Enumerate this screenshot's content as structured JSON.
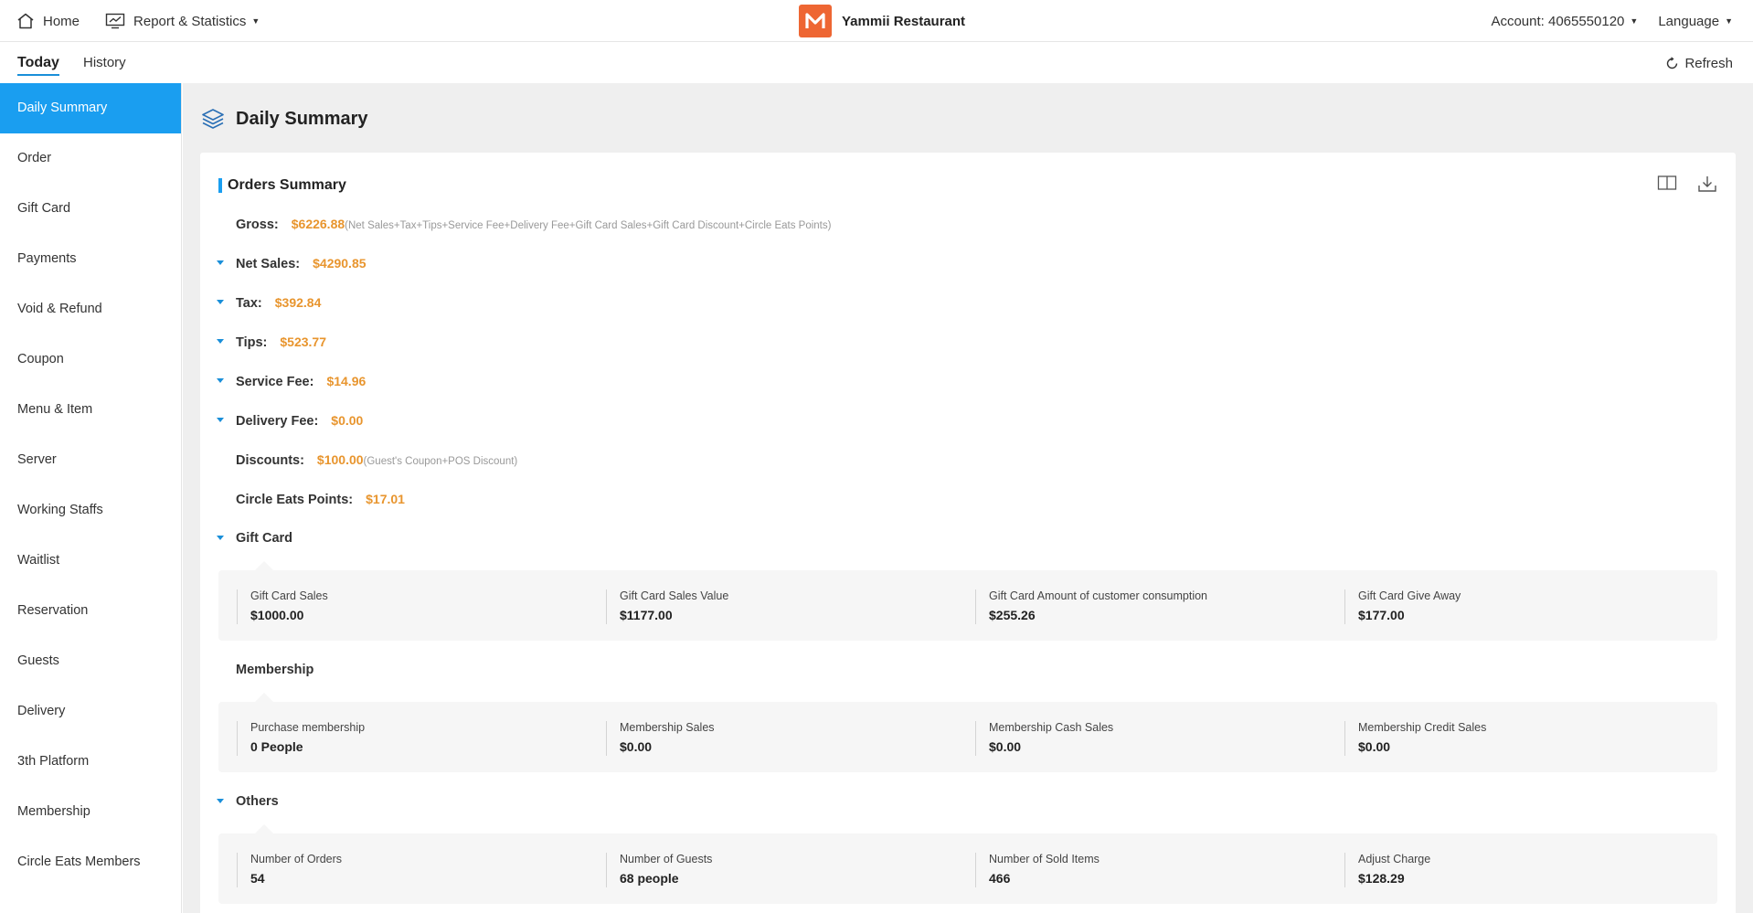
{
  "header": {
    "home_label": "Home",
    "report_label": "Report & Statistics",
    "brand_name": "Yammii Restaurant",
    "account_label": "Account: 4065550120",
    "language_label": "Language"
  },
  "subnav": {
    "tabs": [
      {
        "label": "Today",
        "active": true
      },
      {
        "label": "History",
        "active": false
      }
    ],
    "refresh_label": "Refresh"
  },
  "sidebar": {
    "items": [
      {
        "label": "Daily Summary",
        "active": true
      },
      {
        "label": "Order"
      },
      {
        "label": "Gift Card"
      },
      {
        "label": "Payments"
      },
      {
        "label": "Void & Refund"
      },
      {
        "label": "Coupon"
      },
      {
        "label": "Menu & Item"
      },
      {
        "label": "Server"
      },
      {
        "label": "Working Staffs"
      },
      {
        "label": "Waitlist"
      },
      {
        "label": "Reservation"
      },
      {
        "label": "Guests"
      },
      {
        "label": "Delivery"
      },
      {
        "label": "3th Platform"
      },
      {
        "label": "Membership"
      },
      {
        "label": "Circle Eats Members"
      }
    ]
  },
  "page": {
    "title": "Daily Summary",
    "section_title": "Orders Summary"
  },
  "summary": {
    "gross": {
      "label": "Gross:",
      "value": "$6226.88",
      "note": "(Net Sales+Tax+Tips+Service Fee+Delivery Fee+Gift Card Sales+Gift Card Discount+Circle Eats Points)"
    },
    "net_sales": {
      "label": "Net Sales:",
      "value": "$4290.85"
    },
    "tax": {
      "label": "Tax:",
      "value": "$392.84"
    },
    "tips": {
      "label": "Tips:",
      "value": "$523.77"
    },
    "service_fee": {
      "label": "Service Fee:",
      "value": "$14.96"
    },
    "delivery_fee": {
      "label": "Delivery Fee:",
      "value": "$0.00"
    },
    "discounts": {
      "label": "Discounts:",
      "value": "$100.00",
      "note": "(Guest's Coupon+POS Discount)"
    },
    "circle_points": {
      "label": "Circle Eats Points:",
      "value": "$17.01"
    }
  },
  "gift_card": {
    "title": "Gift Card",
    "stats": [
      {
        "label": "Gift Card Sales",
        "value": "$1000.00"
      },
      {
        "label": "Gift Card Sales Value",
        "value": "$1177.00"
      },
      {
        "label": "Gift Card Amount of customer consumption",
        "value": "$255.26"
      },
      {
        "label": "Gift Card Give Away",
        "value": "$177.00"
      }
    ]
  },
  "membership": {
    "title": "Membership",
    "stats": [
      {
        "label": "Purchase membership",
        "value": "0 People"
      },
      {
        "label": "Membership Sales",
        "value": "$0.00"
      },
      {
        "label": "Membership Cash Sales",
        "value": "$0.00"
      },
      {
        "label": "Membership Credit Sales",
        "value": "$0.00"
      }
    ]
  },
  "others": {
    "title": "Others",
    "stats": [
      {
        "label": "Number of Orders",
        "value": "54"
      },
      {
        "label": "Number of Guests",
        "value": "68 people"
      },
      {
        "label": "Number of Sold Items",
        "value": "466"
      },
      {
        "label": "Adjust Charge",
        "value": "$128.29"
      }
    ]
  },
  "colors": {
    "accent": "#1a9ef0",
    "amount": "#e8952e",
    "brand": "#ee6633"
  }
}
